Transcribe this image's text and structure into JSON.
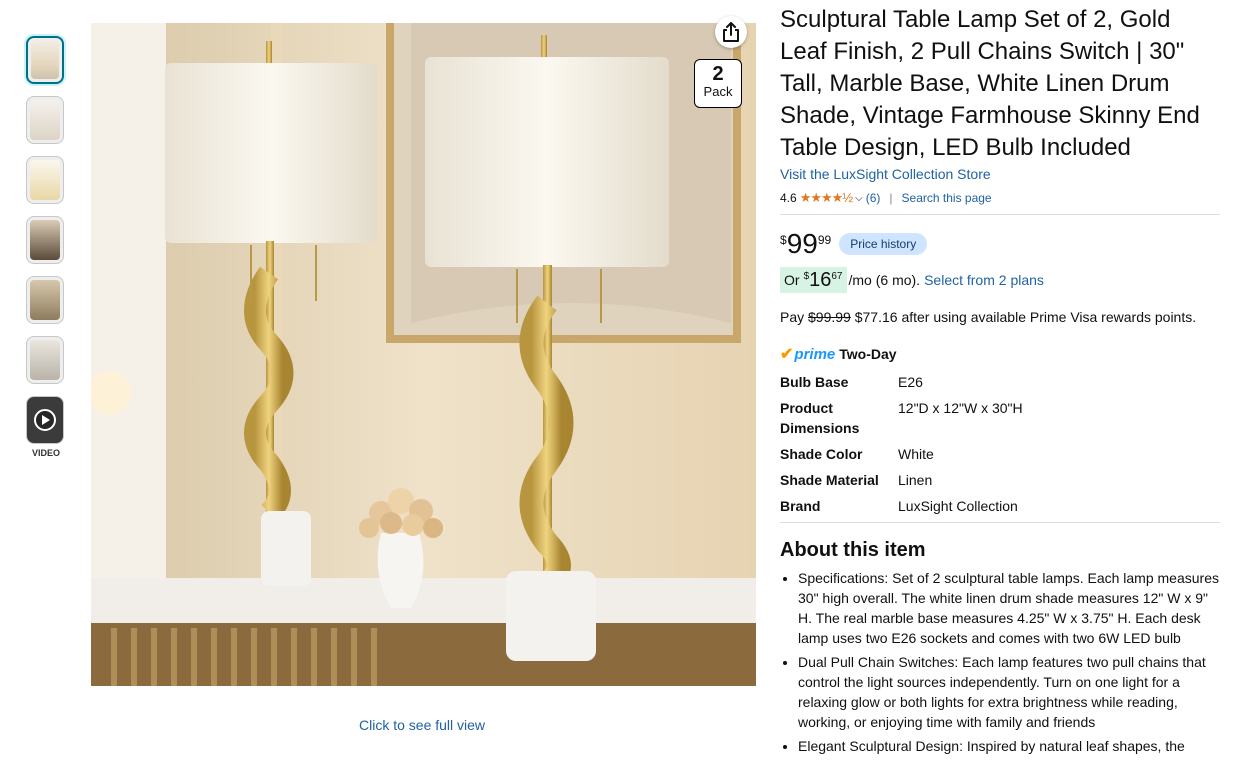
{
  "gallery": {
    "video_label": "VIDEO",
    "pack": {
      "number": "2",
      "text": "Pack"
    },
    "full_view_text": "Click to see full view"
  },
  "product": {
    "title": "Sculptural Table Lamp Set of 2, Gold Leaf Finish, 2 Pull Chains Switch | 30\" Tall, Marble Base, White Linen Drum Shade, Vintage Farmhouse Skinny End Table Design, LED Bulb Included",
    "store_link": "Visit the LuxSight Collection Store",
    "rating_value": "4.6",
    "rating_stars": "★★★★½",
    "rating_count": "(6)",
    "search_page": "Search this page",
    "price": {
      "currency": "$",
      "whole": "99",
      "fraction": "99"
    },
    "price_history": "Price history",
    "monthly": {
      "prefix": "Or",
      "currency": "$",
      "whole": "16",
      "fraction": "67",
      "suffix": "/mo (6 mo).",
      "plans_link": "Select from 2 plans"
    },
    "visa": {
      "pay": "Pay",
      "old_price": "$99.99",
      "new_price": "$77.16",
      "rest": "after using available Prime Visa rewards points."
    },
    "prime": {
      "word": "prime",
      "delivery": "Two-Day"
    },
    "specs": [
      {
        "key": "Bulb Base",
        "value": "E26"
      },
      {
        "key": "Product Dimensions",
        "value": "12\"D x 12\"W x 30\"H"
      },
      {
        "key": "Shade Color",
        "value": "White"
      },
      {
        "key": "Shade Material",
        "value": "Linen"
      },
      {
        "key": "Brand",
        "value": "LuxSight Collection"
      }
    ],
    "about_heading": "About this item",
    "bullets": [
      "Specifications: Set of 2 sculptural table lamps. Each lamp measures 30\" high overall. The white linen drum shade measures 12\" W x 9\" H. The real marble base measures 4.25\" W x 3.75\" H. Each desk lamp uses two E26 sockets and comes with two 6W LED bulb",
      "Dual Pull Chain Switches: Each lamp features two pull chains that control the light sources independently. Turn on one light for a relaxing glow or both lights for extra brightness while reading, working, or enjoying time with family and friends",
      "Elegant Sculptural Design: Inspired by natural leaf shapes, the"
    ]
  },
  "colors": {
    "link": "#2162a1",
    "star": "#de7921",
    "prime": "#1a98ff",
    "price_history_bg": "#cfe4ff",
    "monthly_bg": "#d7f3e3"
  }
}
